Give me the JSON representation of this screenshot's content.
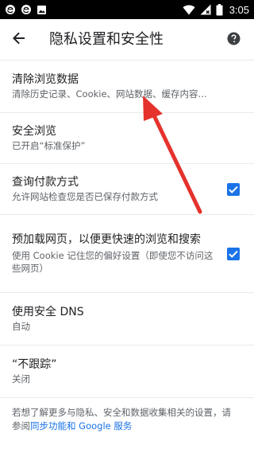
{
  "status_bar": {
    "time": "3:05",
    "icons": [
      "browser-e-icon",
      "browser-e-icon",
      "image-icon",
      "wifi-icon",
      "battery-x-icon",
      "battery-icon"
    ]
  },
  "app_bar": {
    "title": "隐私设置和安全性",
    "back_icon": "arrow-back-icon",
    "help_icon": "help-icon"
  },
  "items": [
    {
      "title": "清除浏览数据",
      "subtitle": "清除历史记录、Cookie、网站数据、缓存内容..."
    },
    {
      "title": "安全浏览",
      "subtitle": "已开启“标准保护”"
    },
    {
      "title": "查询付款方式",
      "subtitle": "允许网站检查您是否已保存付款方式",
      "checked": true
    },
    {
      "title": "预加载网页，以便更快速的浏览和搜索",
      "subtitle": "使用 Cookie 记住您的偏好设置（即使您不访问这些网页）",
      "checked": true
    },
    {
      "title": "使用安全 DNS",
      "subtitle": "自动"
    },
    {
      "title": "“不跟踪”",
      "subtitle": "关闭"
    }
  ],
  "footer": {
    "text": "若想了解更多与隐私、安全和数据收集相关的设置，请参阅",
    "link": "同步功能和 Google 服务"
  },
  "colors": {
    "accent": "#1a73e8",
    "arrow": "#e5322d",
    "divider": "#e8eaed"
  }
}
